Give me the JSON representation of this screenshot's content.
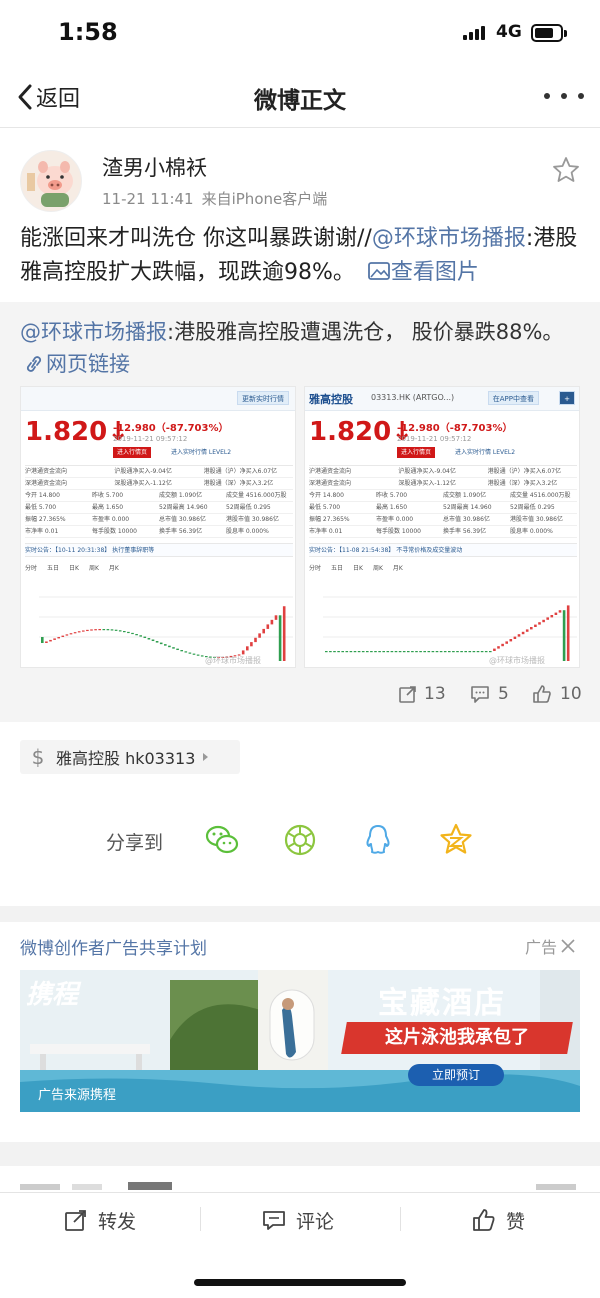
{
  "status_bar": {
    "time": "1:58",
    "network": "4G",
    "battery_level": 0.75
  },
  "nav": {
    "back_label": "返回",
    "title": "微博正文",
    "more_icon": "more-dots-icon"
  },
  "post": {
    "author": "渣男小棉袄",
    "timestamp": "11-21 11:41",
    "source": "来自iPhone客户端",
    "text_before": "能涨回来才叫洗仓 你这叫暴跌谢谢//",
    "mention": "@环球市场播报",
    "text_after": ":港股雅高控股扩大跌幅，现跌逾98%。",
    "view_image_label": "查看图片"
  },
  "repost": {
    "mention": "@环球市场播报",
    "text": ":港股雅高控股遭遇洗仓， 股价暴跌88%。",
    "link_label": "网页链接",
    "shots": [
      {
        "brand": "",
        "code": "",
        "price": "1.820",
        "change": "-12.980（-87.703%）",
        "date": "2019-11-21 09:57:12",
        "tag": "进入行情页",
        "tag2": "进入实时行情 LEVEL2",
        "btn": "更新实时行情",
        "rows": [
          [
            "沪港通资金流向",
            "沪股通净买入-9.04亿",
            "港股通（沪）净买入6.07亿"
          ],
          [
            "深港通资金流向",
            "深股通净买入-1.12亿",
            "港股通（深）净买入3.2亿"
          ],
          [
            "今开 14.800",
            "昨收 5.700",
            "成交额 1.090亿",
            "成交量 4516.000万股"
          ],
          [
            "最低 5.700",
            "最高 1.650",
            "52周最高 14.960",
            "52周最低 0.295"
          ],
          [
            "振幅 27.365%",
            "市盈率 0.000",
            "总市值 30.986亿",
            "港股市值 30.986亿"
          ],
          [
            "市净率 0.01",
            "每手股数 10000",
            "换手率 56.39亿",
            "股息率 0.000%"
          ]
        ],
        "notice": "实时公告：【10-11 20:31:38】 执行董事辞职等",
        "tabs": [
          "分时",
          "五日",
          "日K",
          "周K",
          "月K"
        ],
        "watermark": "@环球市场播报"
      },
      {
        "brand": "雅高控股",
        "code": "03313.HK (ARTGO...)",
        "price": "1.820",
        "change": "-12.980（-87.703%）",
        "date": "2019-11-21 09:57:12",
        "tag": "进入行情页",
        "tag2": "进入实时行情 LEVEL2",
        "btn": "在APP中查看",
        "rows": [
          [
            "沪港通资金流向",
            "沪股通净买入-9.04亿",
            "港股通（沪）净买入6.07亿"
          ],
          [
            "深港通资金流向",
            "深股通净买入-1.12亿",
            "港股通（深）净买入3.2亿"
          ],
          [
            "今开 14.800",
            "昨收 5.700",
            "成交额 1.090亿",
            "成交量 4516.000万股"
          ],
          [
            "最低 5.700",
            "最高 1.650",
            "52周最高 14.960",
            "52周最低 0.295"
          ],
          [
            "振幅 27.365%",
            "市盈率 0.000",
            "总市值 30.986亿",
            "港股市值 30.986亿"
          ],
          [
            "市净率 0.01",
            "每手股数 10000",
            "换手率 56.39亿",
            "股息率 0.000%"
          ]
        ],
        "notice": "实时公告：【11-08 21:54:38】 不寻常价格及成交量波动",
        "tabs": [
          "分时",
          "五日",
          "日K",
          "周K",
          "月K"
        ],
        "watermark": "@环球市场播报"
      }
    ]
  },
  "actions": {
    "repost_count": "13",
    "comment_count": "5",
    "like_count": "10"
  },
  "stock_chip": {
    "symbol": "$",
    "label": "雅高控股 hk03313"
  },
  "share": {
    "label": "分享到",
    "targets": [
      "wechat-icon",
      "moments-icon",
      "qq-icon",
      "qzone-icon"
    ],
    "colors": {
      "wechat": "#5bbf3a",
      "moments": "#8cc63f",
      "qq": "#4fa9e6",
      "qzone": "#f2b41c"
    }
  },
  "ad": {
    "title": "微博创作者广告共享计划",
    "tag": "广告",
    "brand": "携程",
    "headline": "宝藏酒店",
    "slogan": "这片泳池我承包了",
    "cta": "立即预订",
    "source": "广告来源携程"
  },
  "bottom_bar": {
    "repost": "转发",
    "comment": "评论",
    "like": "赞"
  },
  "colors": {
    "link": "#5475a6",
    "price_red": "#d01818",
    "band": "#f2f2f2"
  }
}
